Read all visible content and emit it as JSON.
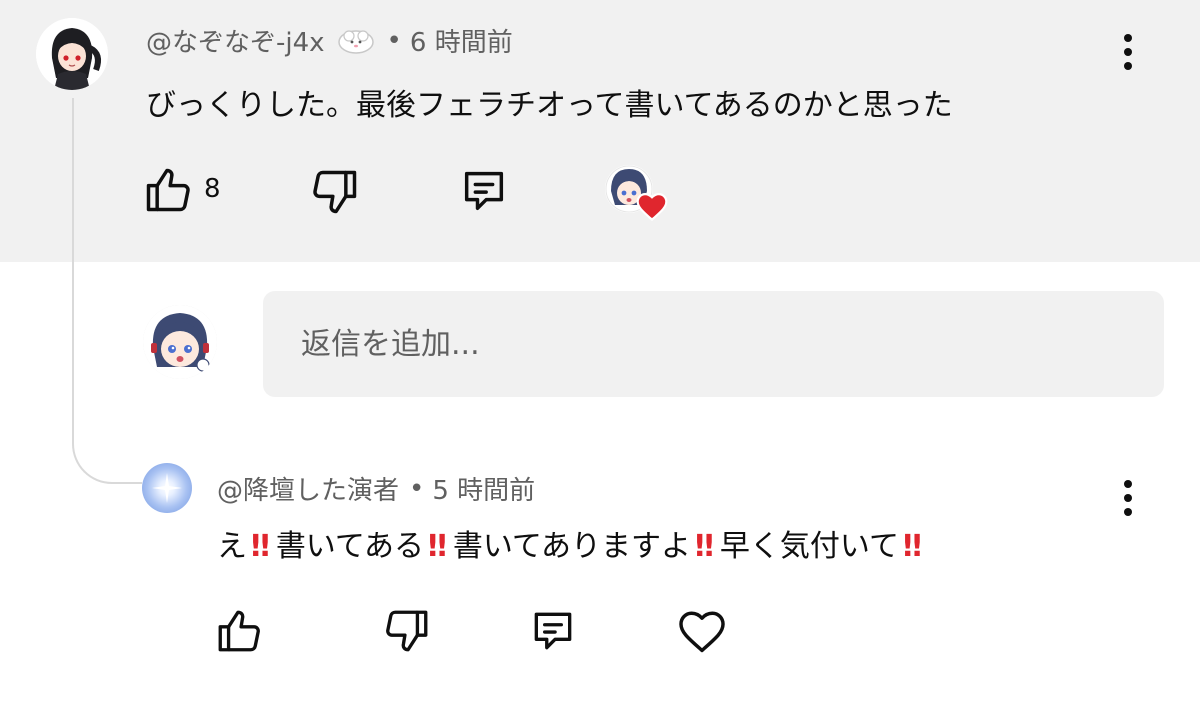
{
  "comment": {
    "author": "@なぞなぞ-j4x",
    "time": "6 時間前",
    "text": "びっくりした。最後フェラチオって書いてあるのかと思った",
    "likes": "8",
    "actions": {
      "like_icon": "thumbs-up-icon",
      "dislike_icon": "thumbs-down-icon",
      "reply_icon": "comment-icon",
      "creator_heart": "creator-heart-badge"
    }
  },
  "reply_input": {
    "placeholder": "返信を追加..."
  },
  "reply": {
    "author": "@降壇した演者",
    "time": "5 時間前",
    "segments": [
      "え",
      "書いてある",
      "書いてありますよ",
      "早く気付いて"
    ],
    "emphasis": "‼"
  },
  "separator": "•",
  "colors": {
    "highlight_bg": "#f1f1f1",
    "secondary_text": "#606060",
    "heart": "#e0262e"
  }
}
